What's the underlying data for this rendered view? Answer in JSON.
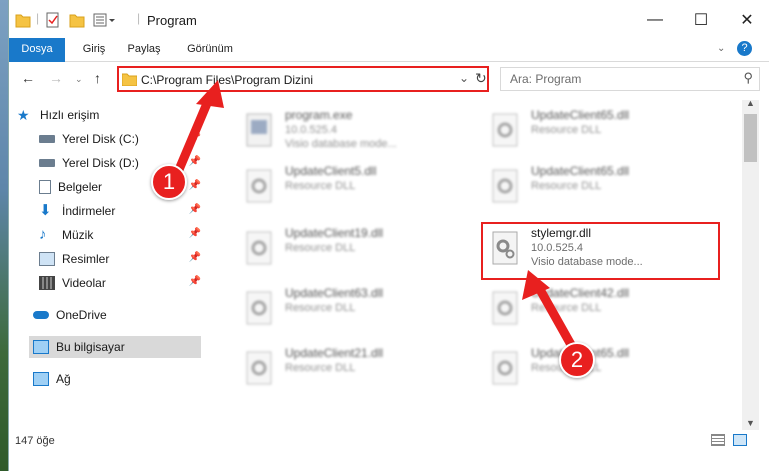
{
  "window": {
    "title": "Program"
  },
  "controls": {
    "minimize": "—",
    "maximize": "☐",
    "close": "✕"
  },
  "ribbon": {
    "tabs": [
      "Dosya",
      "Giriş",
      "Paylaş",
      "Görünüm"
    ],
    "help": "?"
  },
  "nav": {
    "address": "C:\\Program Files\\Program Dizini",
    "search_placeholder": "Ara: Program"
  },
  "sidebar": {
    "items": [
      {
        "label": "Hızlı erişim",
        "icon": "star-icon"
      },
      {
        "label": "Yerel Disk (C:)",
        "icon": "drive-icon",
        "pinned": true
      },
      {
        "label": "Yerel Disk (D:)",
        "icon": "drive-icon",
        "pinned": true
      },
      {
        "label": "Belgeler",
        "icon": "documents-icon",
        "pinned": true
      },
      {
        "label": "İndirmeler",
        "icon": "download-icon",
        "pinned": true
      },
      {
        "label": "Müzik",
        "icon": "music-icon",
        "pinned": true
      },
      {
        "label": "Resimler",
        "icon": "pictures-icon",
        "pinned": true
      },
      {
        "label": "Videolar",
        "icon": "video-icon",
        "pinned": true
      },
      {
        "label": "OneDrive",
        "icon": "cloud-icon"
      },
      {
        "label": "Bu bilgisayar",
        "icon": "computer-icon",
        "selected": true
      },
      {
        "label": "Ağ",
        "icon": "network-icon"
      }
    ]
  },
  "files": [
    {
      "name": "program.exe",
      "line2": "10.0.525.4",
      "line3": "Visio database mode..."
    },
    {
      "name": "UpdateClient65.dll",
      "line2": "Resource DLL",
      "line3": ""
    },
    {
      "name": "UpdateClient5.dll",
      "line2": "Resource DLL",
      "line3": ""
    },
    {
      "name": "UpdateClient65.dll",
      "line2": "Resource DLL",
      "line3": ""
    },
    {
      "name": "UpdateClient19.dll",
      "line2": "Resource DLL",
      "line3": ""
    },
    {
      "name": "stylemgr.dll",
      "line2": "10.0.525.4",
      "line3": "Visio database mode..."
    },
    {
      "name": "UpdateClient63.dll",
      "line2": "Resource DLL",
      "line3": ""
    },
    {
      "name": "UpdateClient42.dll",
      "line2": "Resource DLL",
      "line3": ""
    },
    {
      "name": "UpdateClient21.dll",
      "line2": "Resource DLL",
      "line3": ""
    },
    {
      "name": "UpdateClient65.dll",
      "line2": "Resource DLL",
      "line3": ""
    }
  ],
  "status": {
    "count": "147 öğe"
  },
  "callouts": [
    "1",
    "2"
  ],
  "colors": {
    "accent": "#1979ca",
    "highlight": "#e8201f"
  }
}
